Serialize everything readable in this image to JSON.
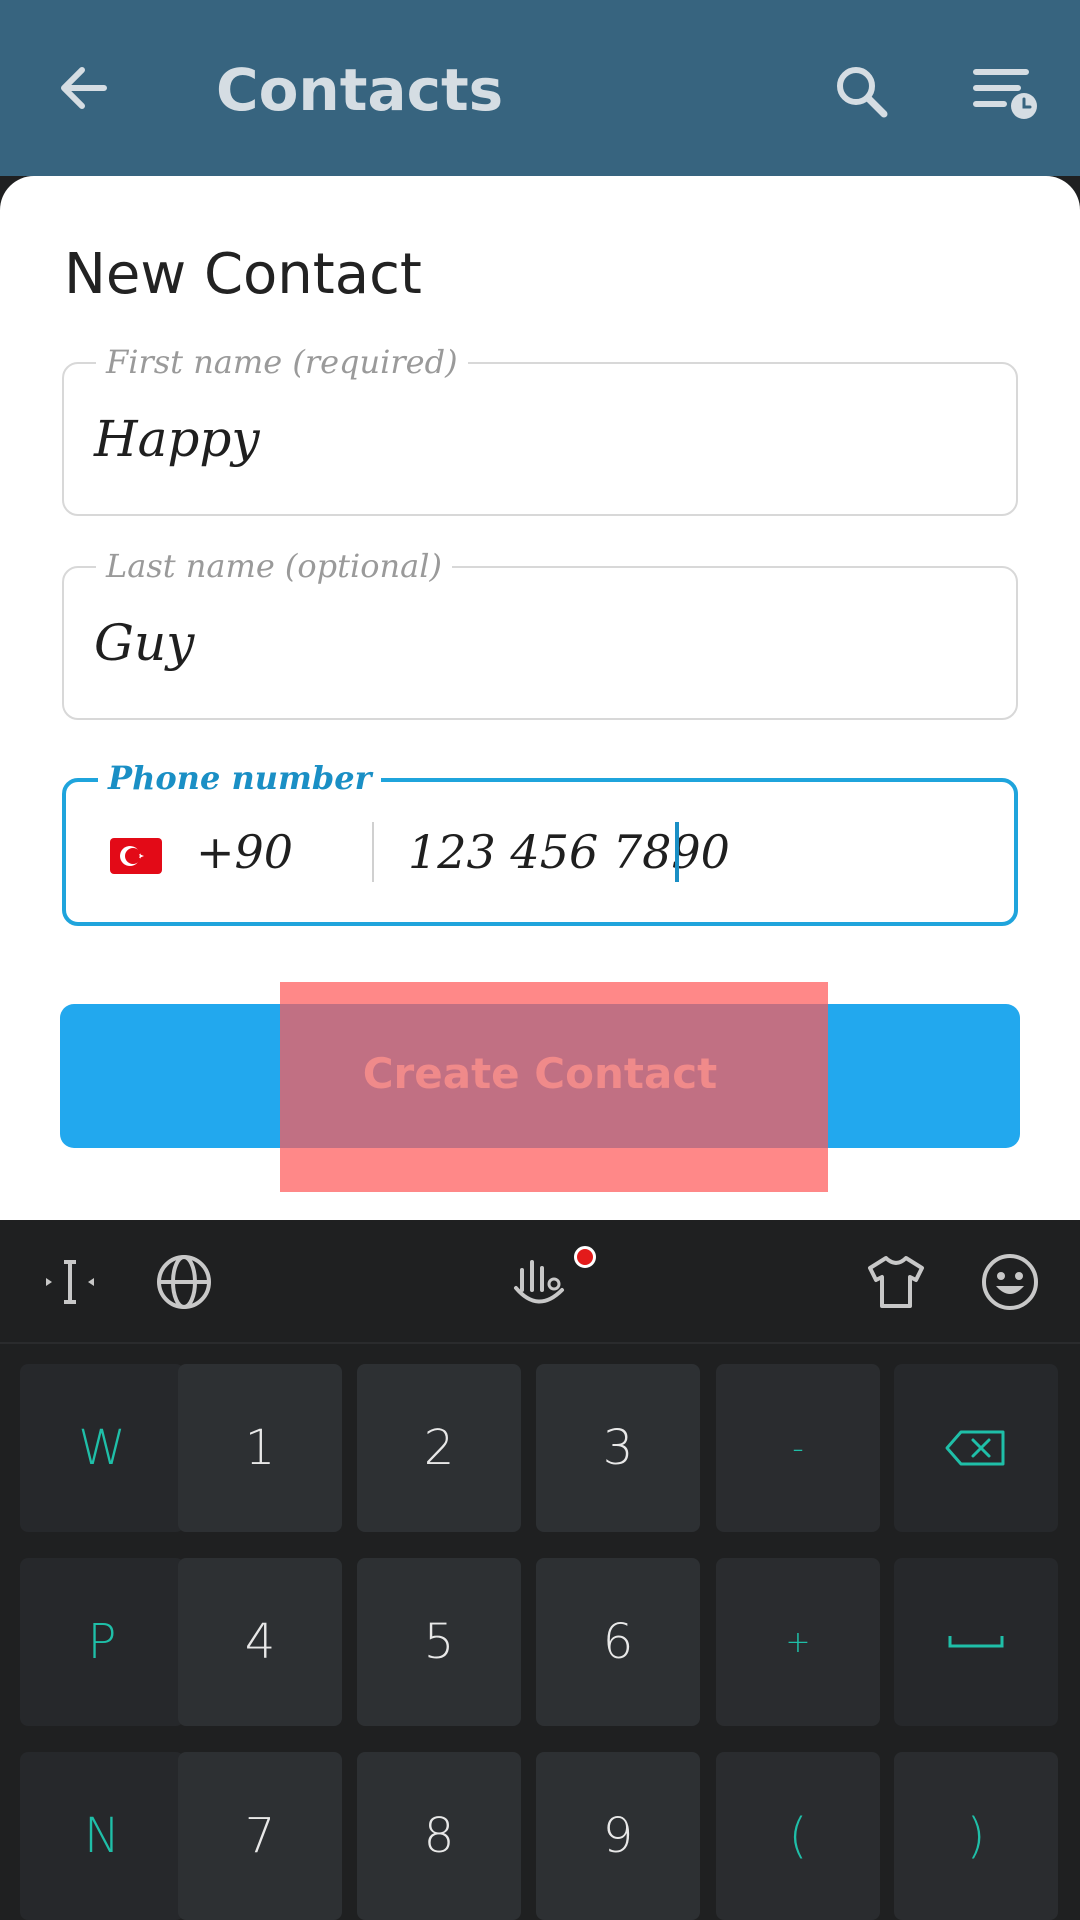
{
  "appbar": {
    "title": "Contacts",
    "back_icon": "arrow-left-icon",
    "search_icon": "search-icon",
    "sort_icon": "filter-clock-icon"
  },
  "sheet": {
    "title": "New Contact",
    "first_name": {
      "label": "First name (required)",
      "value": "Happy"
    },
    "last_name": {
      "label": "Last name (optional)",
      "value": "Guy"
    },
    "phone": {
      "label": "Phone number",
      "country_flag": "turkey-flag",
      "country_code": "+90",
      "number": "123 456 7890"
    },
    "create_button": "Create Contact"
  },
  "keyboard": {
    "toolbar_icons": [
      "text-cursor-icon",
      "globe-icon",
      "gesture-hand-icon",
      "shirt-icon",
      "emoji-icon"
    ],
    "rows": [
      [
        {
          "label": "W",
          "kind": "side"
        },
        {
          "label": "1"
        },
        {
          "label": "2"
        },
        {
          "label": "3"
        },
        {
          "label": "-",
          "kind": "sym"
        },
        {
          "label": "backspace",
          "kind": "icon"
        }
      ],
      [
        {
          "label": "P",
          "kind": "side"
        },
        {
          "label": "4"
        },
        {
          "label": "5"
        },
        {
          "label": "6"
        },
        {
          "label": "+",
          "kind": "sym"
        },
        {
          "label": "space",
          "kind": "icon"
        }
      ],
      [
        {
          "label": "N",
          "kind": "side"
        },
        {
          "label": "7"
        },
        {
          "label": "8"
        },
        {
          "label": "9"
        },
        {
          "label": "(",
          "kind": "sym"
        },
        {
          "label": ")",
          "kind": "sym"
        }
      ]
    ]
  },
  "colors": {
    "appbar": "#37647f",
    "accent": "#1fa4dc",
    "button": "#22a8ee",
    "keyboard_accent": "#1fbfa8"
  }
}
